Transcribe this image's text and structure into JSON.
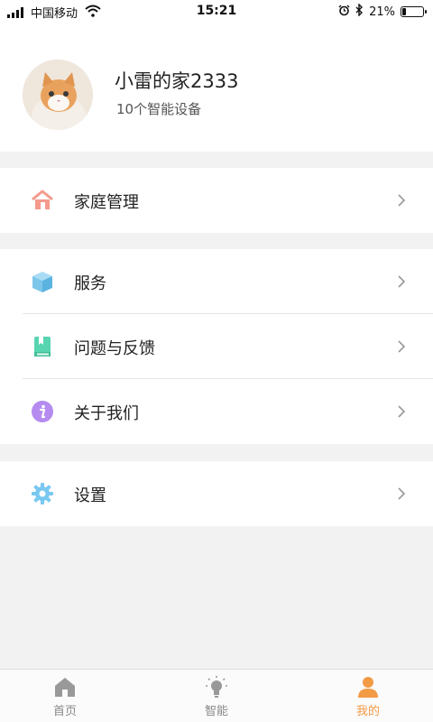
{
  "status_bar": {
    "carrier": "中国移动",
    "time": "15:21",
    "battery": "21%",
    "battery_level": 0.21,
    "icons": [
      "signal-icon",
      "wifi-icon",
      "alarm-icon",
      "bluetooth-icon",
      "battery-icon"
    ]
  },
  "profile": {
    "home_name": "小雷的家2333",
    "device_count": "10个智能设备",
    "avatar_icon": "cat-avatar"
  },
  "menu": {
    "home_management": {
      "label": "家庭管理",
      "icon": "house-icon",
      "color": "#f59a8c"
    },
    "service": {
      "label": "服务",
      "icon": "cube-icon",
      "color": "#7cc6ea"
    },
    "feedback": {
      "label": "问题与反馈",
      "icon": "book-icon",
      "color": "#57d4b0"
    },
    "about": {
      "label": "关于我们",
      "icon": "info-icon",
      "color": "#b58bf0"
    },
    "settings": {
      "label": "设置",
      "icon": "gear-icon",
      "color": "#79c8f0"
    }
  },
  "tabbar": {
    "home": {
      "label": "首页",
      "icon": "home-icon"
    },
    "smart": {
      "label": "智能",
      "icon": "lightbulb-icon"
    },
    "mine": {
      "label": "我的",
      "icon": "person-icon",
      "active": true
    }
  },
  "colors": {
    "accent": "#f39a45",
    "background": "#f2f2f2",
    "inactive_tab": "#999999"
  }
}
